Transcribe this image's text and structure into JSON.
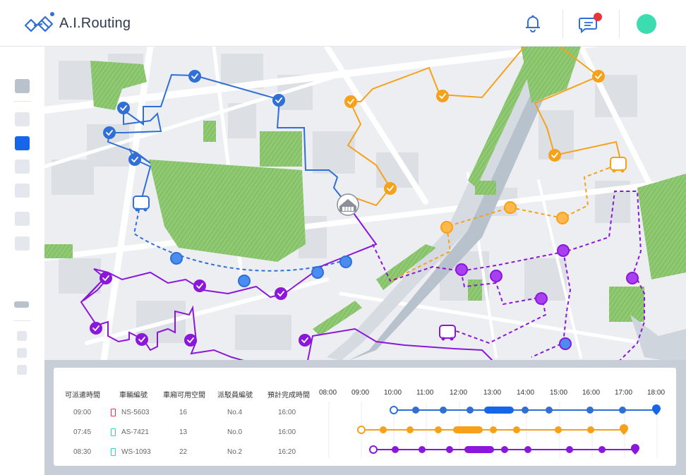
{
  "app": {
    "title": "A.I.Routing"
  },
  "header": {
    "icons": [
      "bell-icon",
      "chat-icon",
      "avatar"
    ],
    "notification_dot_color": "#e8353a",
    "avatar_color": "#3ddbb0"
  },
  "colors": {
    "blue": "#2f6fd6",
    "orange": "#f5a21a",
    "purple": "#8a17d9",
    "park": "#8fc972"
  },
  "table": {
    "headers": [
      "可派遣時間",
      "車輛編號",
      "車廂可用空間",
      "派駁員編號",
      "預計完成時間"
    ],
    "rows": [
      {
        "time": "09:00",
        "vehicle": "NS-5603",
        "space": "16",
        "driver": "No.4",
        "eta": "16:00",
        "color": "#e8353a"
      },
      {
        "time": "07:45",
        "vehicle": "AS-7421",
        "space": "13",
        "driver": "No.0",
        "eta": "16:00",
        "color": "#33d4b6"
      },
      {
        "time": "08:30",
        "vehicle": "WS-1093",
        "space": "22",
        "driver": "No.2",
        "eta": "16:20",
        "color": "#33d4b6"
      }
    ]
  },
  "timeline": {
    "ticks": [
      "08:00",
      "09:00",
      "10:00",
      "11:00",
      "12:00",
      "13:00",
      "14:00",
      "15:00",
      "16:00",
      "17:00",
      "18:00"
    ]
  }
}
